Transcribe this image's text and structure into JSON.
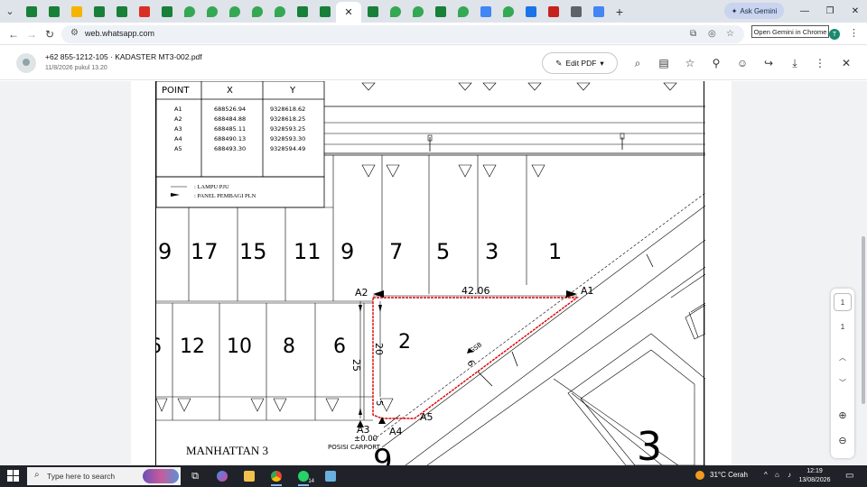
{
  "browser": {
    "tabs": [
      {
        "icon": "sheets-icon",
        "color": "#188038"
      },
      {
        "icon": "sheets-icon",
        "color": "#188038"
      },
      {
        "icon": "drive-icon",
        "color": "#f4b400"
      },
      {
        "icon": "sheets-icon",
        "color": "#188038"
      },
      {
        "icon": "sheets-icon",
        "color": "#188038"
      },
      {
        "icon": "gmail-icon",
        "color": "#d93025"
      },
      {
        "icon": "sheets-icon",
        "color": "#188038"
      },
      {
        "icon": "maps-icon",
        "color": "#34a853"
      },
      {
        "icon": "maps-icon",
        "color": "#34a853"
      },
      {
        "icon": "maps-icon",
        "color": "#34a853"
      },
      {
        "icon": "maps-icon",
        "color": "#34a853"
      },
      {
        "icon": "maps-icon",
        "color": "#34a853"
      },
      {
        "icon": "sheets-icon",
        "color": "#188038"
      },
      {
        "icon": "sheets-icon",
        "color": "#188038"
      },
      {
        "icon": "whatsapp-tab-active",
        "color": "#ffffff",
        "label": "✕"
      },
      {
        "icon": "sheets-icon",
        "color": "#188038"
      },
      {
        "icon": "maps-icon",
        "color": "#34a853"
      },
      {
        "icon": "maps-icon",
        "color": "#34a853"
      },
      {
        "icon": "sheets-icon",
        "color": "#188038"
      },
      {
        "icon": "maps-icon",
        "color": "#34a853"
      },
      {
        "icon": "drive-icon",
        "color": "#4285f4"
      },
      {
        "icon": "maps-icon",
        "color": "#34a853"
      },
      {
        "icon": "building-icon",
        "color": "#1a73e8"
      },
      {
        "icon": "home-icon",
        "color": "#c5221f"
      },
      {
        "icon": "doc-icon",
        "color": "#5f6368"
      },
      {
        "icon": "google-icon",
        "color": "#4285f4"
      }
    ],
    "new_tab": "+",
    "ask_gemini": "Ask Gemini",
    "url": "web.whatsapp.com",
    "tooltip": "Open Gemini in Chrome",
    "profile_initial": "T"
  },
  "viewer": {
    "title": "+62 855-1212-105 · KADASTER MT3-002.pdf",
    "timestamp": "11/8/2026 pukul 13.20",
    "edit_pdf": "Edit PDF",
    "page_current": "1",
    "page_total": "1"
  },
  "drawing": {
    "table": {
      "headers": [
        "POINT",
        "X",
        "Y"
      ],
      "rows": [
        [
          "A1",
          "688526.94",
          "9328618.62"
        ],
        [
          "A2",
          "688484.88",
          "9328618.25"
        ],
        [
          "A3",
          "688485.11",
          "9328593.25"
        ],
        [
          "A4",
          "688490.13",
          "9328593.30"
        ],
        [
          "A5",
          "688493.30",
          "9328594.49"
        ]
      ]
    },
    "legend": [
      ": LAMPU PJU",
      ": PANEL PEMBAGI PLN"
    ],
    "lots_top": [
      "9",
      "17",
      "15",
      "11",
      "9",
      "7",
      "5",
      "3",
      "1"
    ],
    "lots_bottom": [
      "6",
      "12",
      "10",
      "8",
      "6",
      "2"
    ],
    "points": [
      "A1",
      "A2",
      "A3",
      "A4",
      "A5"
    ],
    "dims": {
      "top": "42.06",
      "left_outer": "25",
      "left_inner": "20",
      "bottom_small": "5",
      "diag": "6",
      "gsb": "GSB"
    },
    "level": "±0.00",
    "carport": "POSISI CARPORT",
    "block": "MANHATTAN 3",
    "big_number": "3",
    "partial_number": "9"
  },
  "taskbar": {
    "search_placeholder": "Type here to search",
    "whatsapp_badge": "14",
    "weather": "31°C  Cerah",
    "time": "12:19",
    "date": "13/08/2026"
  }
}
